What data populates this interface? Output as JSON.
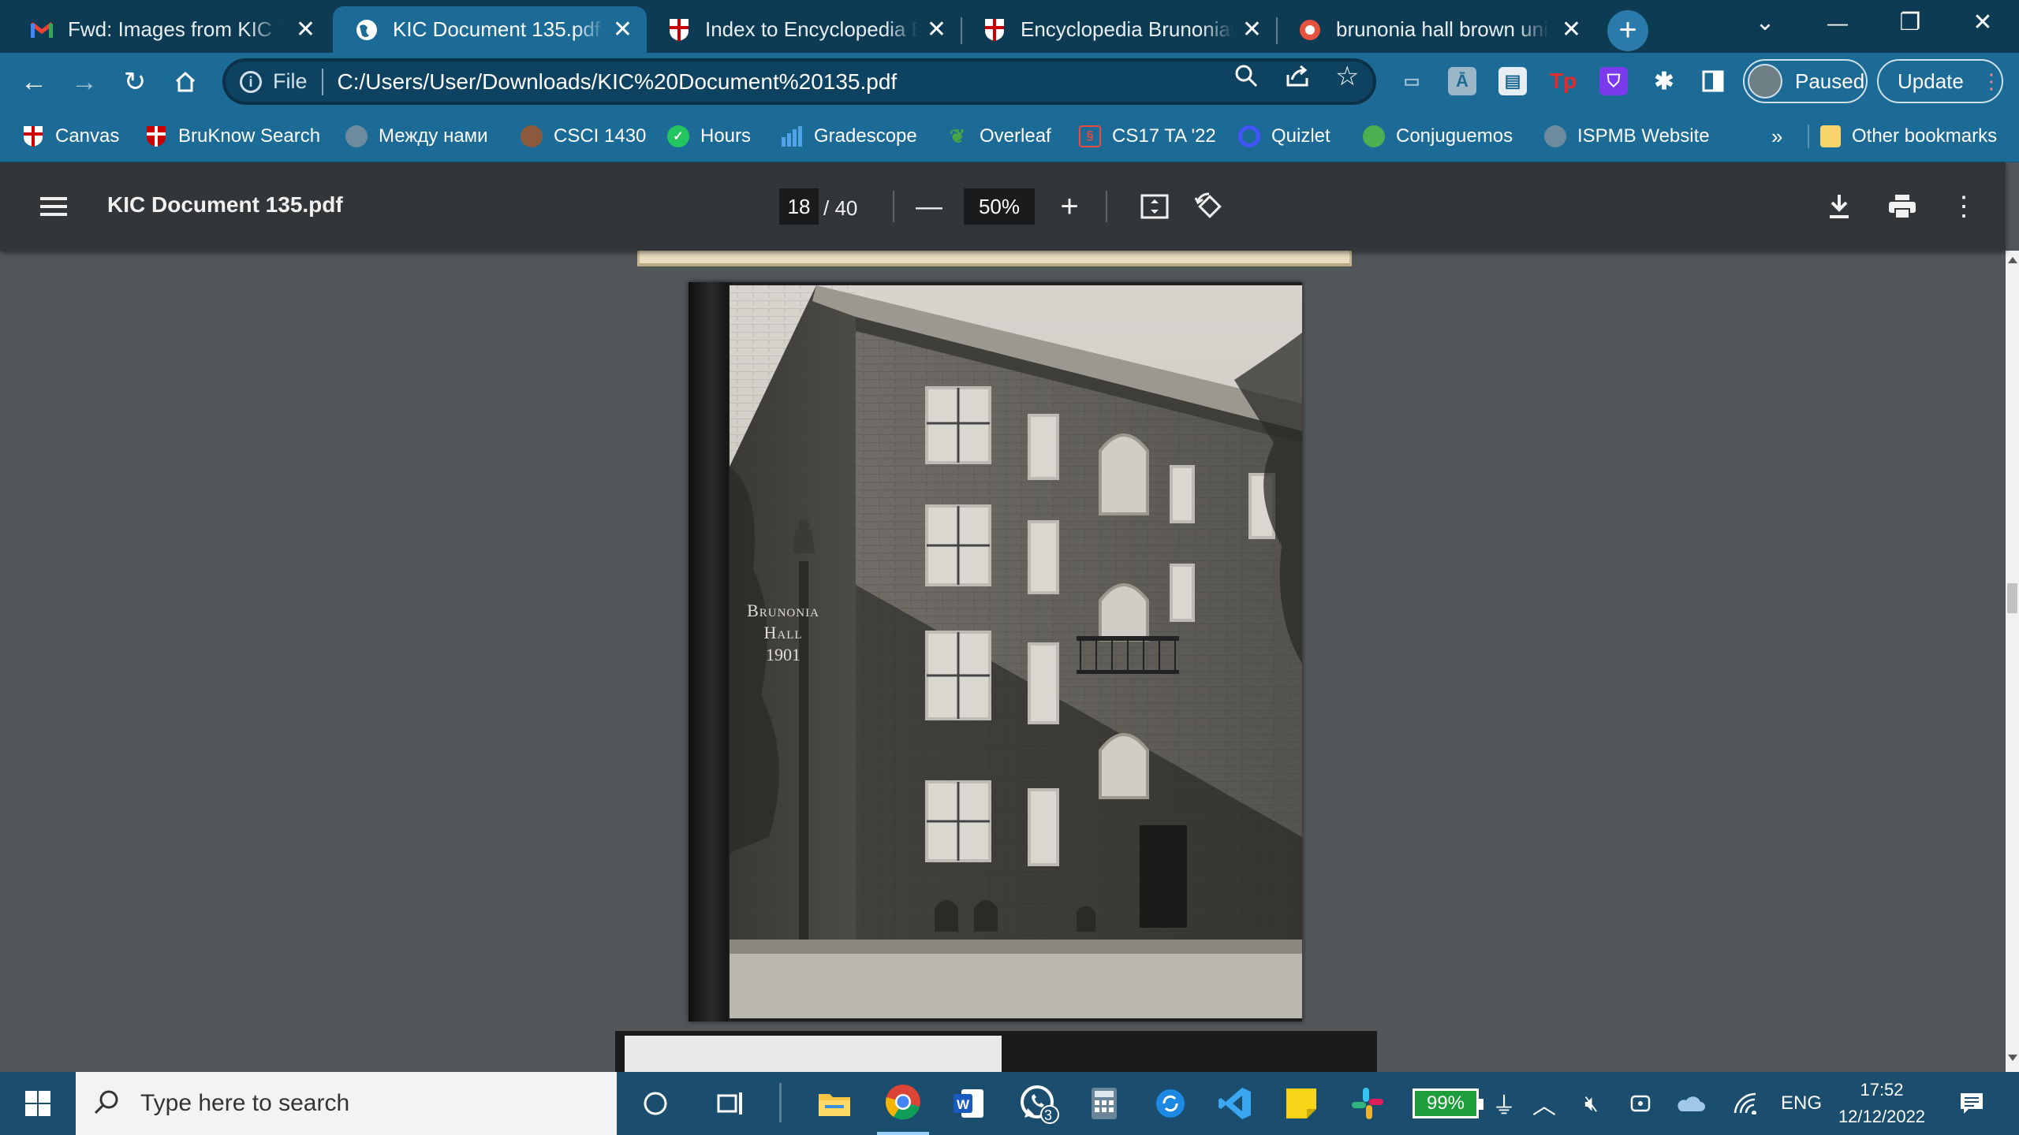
{
  "tabs": [
    {
      "title": "Fwd: Images from KIC Stat",
      "favicon": "gmail-icon",
      "active": false
    },
    {
      "title": "KIC Document 135.pdf",
      "favicon": "globe-icon",
      "active": true
    },
    {
      "title": "Index to Encyclopedia Bru",
      "favicon": "brown-shield-icon",
      "active": false
    },
    {
      "title": "Encyclopedia Brunoniana",
      "favicon": "brown-shield-icon",
      "active": false
    },
    {
      "title": "brunonia hall brown unive",
      "favicon": "google-icon",
      "active": false
    }
  ],
  "window_controls": {
    "tab_search": "⌄",
    "minimize": "—",
    "restore": "❐",
    "close": "✕"
  },
  "address_bar": {
    "scheme_label": "File",
    "url": "C:/Users/User/Downloads/KIC%20Document%20135.pdf"
  },
  "profile": {
    "label": "Paused"
  },
  "update": {
    "label": "Update"
  },
  "bookmarks": [
    {
      "label": "Canvas",
      "icon": "brown-shield-icon"
    },
    {
      "label": "BruKnow Search",
      "icon": "brown-shield-icon"
    },
    {
      "label": "Между нами",
      "icon": "globe-icon"
    },
    {
      "label": "CSCI 1430",
      "icon": "bear-icon"
    },
    {
      "label": "Hours",
      "icon": "check-circle-icon"
    },
    {
      "label": "Gradescope",
      "icon": "bar-chart-icon"
    },
    {
      "label": "Overleaf",
      "icon": "leaf-icon"
    },
    {
      "label": "CS17 TA '22",
      "icon": "brain-icon"
    },
    {
      "label": "Quizlet",
      "icon": "quizlet-icon"
    },
    {
      "label": "Conjuguemos",
      "icon": "frog-icon"
    },
    {
      "label": "ISPMB Website",
      "icon": "globe-icon"
    }
  ],
  "bookmarks_overflow": "»",
  "other_bookmarks": "Other bookmarks",
  "pdf_toolbar": {
    "title": "KIC Document 135.pdf",
    "current_page": "18",
    "total_pages": "/ 40",
    "zoom": "50%"
  },
  "photo_caption": {
    "line1": "Brunonia",
    "line2": "Hall",
    "line3": "1901"
  },
  "taskbar": {
    "search_placeholder": "Type here to search",
    "whatsapp_badge": "3",
    "battery": "99%",
    "language": "ENG",
    "time": "17:52",
    "date": "12/12/2022"
  },
  "colors": {
    "tabstrip": "#0d3b54",
    "toolbar": "#1c6a96",
    "pdf_toolbar": "#323639",
    "viewer_bg": "#525659",
    "taskbar": "#1a4d6e"
  }
}
